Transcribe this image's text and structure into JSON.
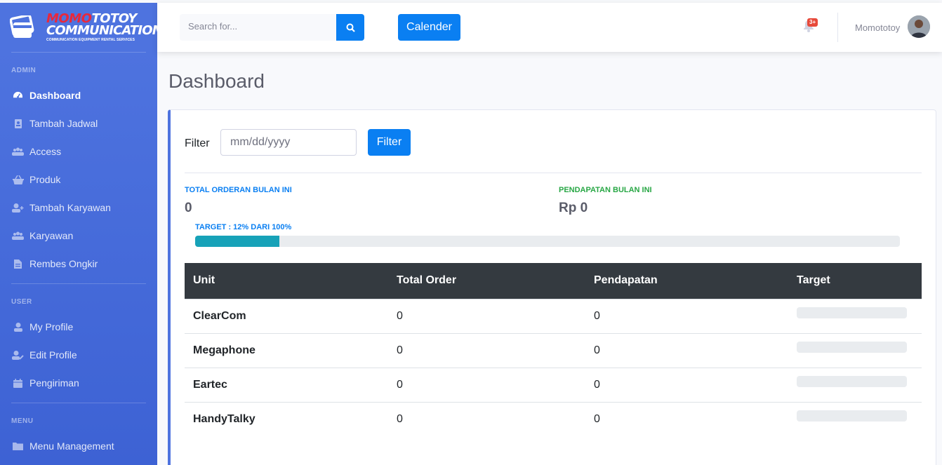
{
  "brand": {
    "line1_red": "MOMO",
    "line1_rest": "TOTOY",
    "line2": "COMMUNICATION",
    "tagline": "COMMUNICATION EQUIPMENT RENTAL SERVICES"
  },
  "sidebar": {
    "sections": [
      {
        "heading": "ADMIN",
        "items": [
          {
            "label": "Dashboard",
            "icon": "tachometer-icon",
            "active": true
          },
          {
            "label": "Tambah Jadwal",
            "icon": "address-book-icon"
          },
          {
            "label": "Access",
            "icon": "users-icon"
          },
          {
            "label": "Produk",
            "icon": "shopping-basket-icon"
          },
          {
            "label": "Tambah Karyawan",
            "icon": "user-plus-icon"
          },
          {
            "label": "Karyawan",
            "icon": "users-icon"
          },
          {
            "label": "Rembes Ongkir",
            "icon": "file-invoice-icon"
          }
        ]
      },
      {
        "heading": "USER",
        "items": [
          {
            "label": "My Profile",
            "icon": "user-icon"
          },
          {
            "label": "Edit Profile",
            "icon": "user-edit-icon"
          },
          {
            "label": "Pengiriman",
            "icon": "calendar-icon"
          }
        ]
      },
      {
        "heading": "MENU",
        "items": [
          {
            "label": "Menu Management",
            "icon": "folder-icon"
          }
        ]
      }
    ]
  },
  "topbar": {
    "search_placeholder": "Search for...",
    "calendar_label": "Calender",
    "alerts_badge": "3+",
    "user_name": "Momototoy"
  },
  "page": {
    "title": "Dashboard"
  },
  "filter": {
    "label": "Filter",
    "date_placeholder": "mm/dd/yyyy",
    "button_label": "Filter"
  },
  "stats": {
    "orders_label": "TOTAL ORDERAN BULAN INI",
    "orders_value": "0",
    "income_label": "PENDAPATAN BULAN INI",
    "income_value": "Rp 0",
    "target_label": "TARGET : 12% DARI 100%",
    "target_percent": 12
  },
  "table": {
    "headers": [
      "Unit",
      "Total Order",
      "Pendapatan",
      "Target"
    ],
    "rows": [
      {
        "unit": "ClearCom",
        "total_order": "0",
        "pendapatan": "0",
        "target_percent": 0
      },
      {
        "unit": "Megaphone",
        "total_order": "0",
        "pendapatan": "0",
        "target_percent": 0
      },
      {
        "unit": "Eartec",
        "total_order": "0",
        "pendapatan": "0",
        "target_percent": 0
      },
      {
        "unit": "HandyTalky",
        "total_order": "0",
        "pendapatan": "0",
        "target_percent": 0
      }
    ]
  },
  "colors": {
    "sidebar": "#4e73df",
    "primary_button": "#0a7ff2",
    "progress": "#17a2b8",
    "table_header": "#343a40",
    "income_label": "#1cc88a",
    "orders_label": "#0a7ff2",
    "badge": "#e74a3b"
  }
}
